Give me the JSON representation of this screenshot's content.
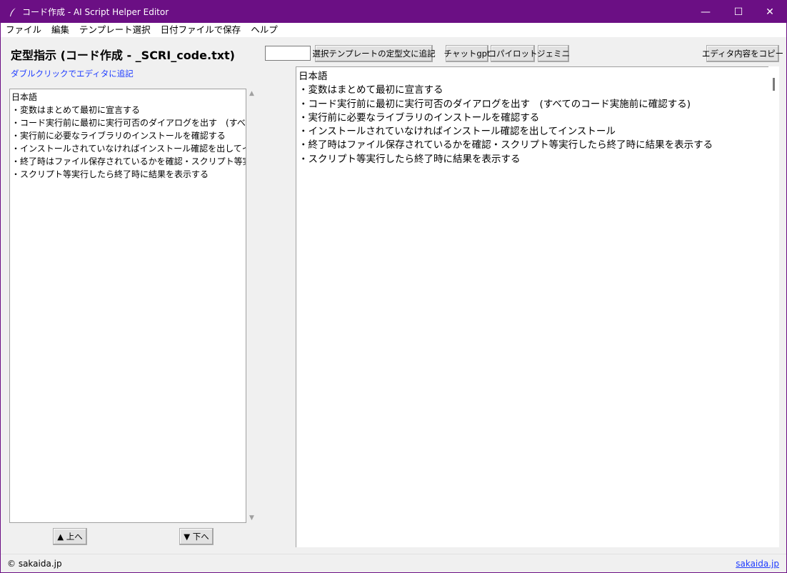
{
  "window": {
    "title": "コード作成 - AI Script Helper Editor",
    "controls": {
      "minimize": "—",
      "maximize": "☐",
      "close": "✕"
    }
  },
  "menu": [
    "ファイル",
    "編集",
    "テンプレート選択",
    "日付ファイルで保存",
    "ヘルプ"
  ],
  "left_panel": {
    "title": "定型指示 (コード作成 - _SCRI_code.txt)",
    "hint": "ダブルクリックでエディタに追記",
    "items": [
      "日本語",
      "・変数はまとめて最初に宣言する",
      "・コード実行前に最初に実行可否のダイアログを出す　(すべてのコード実施前に確認する)",
      "・実行前に必要なライブラリのインストールを確認する",
      "・インストールされていなければインストール確認を出してインストール",
      "・終了時はファイル保存されているかを確認・スクリプト等実行したら終了時に結果を表示する",
      "・スクリプト等実行したら終了時に結果を表示する"
    ],
    "move_up_label": "▲ 上へ",
    "move_down_label": "▼ 下へ"
  },
  "toolbar": {
    "input_value": "",
    "append_label": "選択テンプレートの定型文に追記",
    "chatgpt_label": "チャットgpt",
    "copilot_label": "コパイロット",
    "gemini_label": "ジェミニ",
    "copy_label": "エディタ内容をコピー"
  },
  "editor": {
    "lines": [
      "日本語",
      "・変数はまとめて最初に宣言する",
      "・コード実行前に最初に実行可否のダイアログを出す　(すべてのコード実施前に確認する)",
      "・実行前に必要なライブラリのインストールを確認する",
      "・インストールされていなければインストール確認を出してインストール",
      "・終了時はファイル保存されているかを確認・スクリプト等実行したら終了時に結果を表示する",
      "・スクリプト等実行したら終了時に結果を表示する"
    ]
  },
  "status": {
    "copyright": "© sakaida.jp",
    "link": "sakaida.jp"
  },
  "colors": {
    "titlebar": "#6b0f84",
    "link": "#1e3cff"
  }
}
